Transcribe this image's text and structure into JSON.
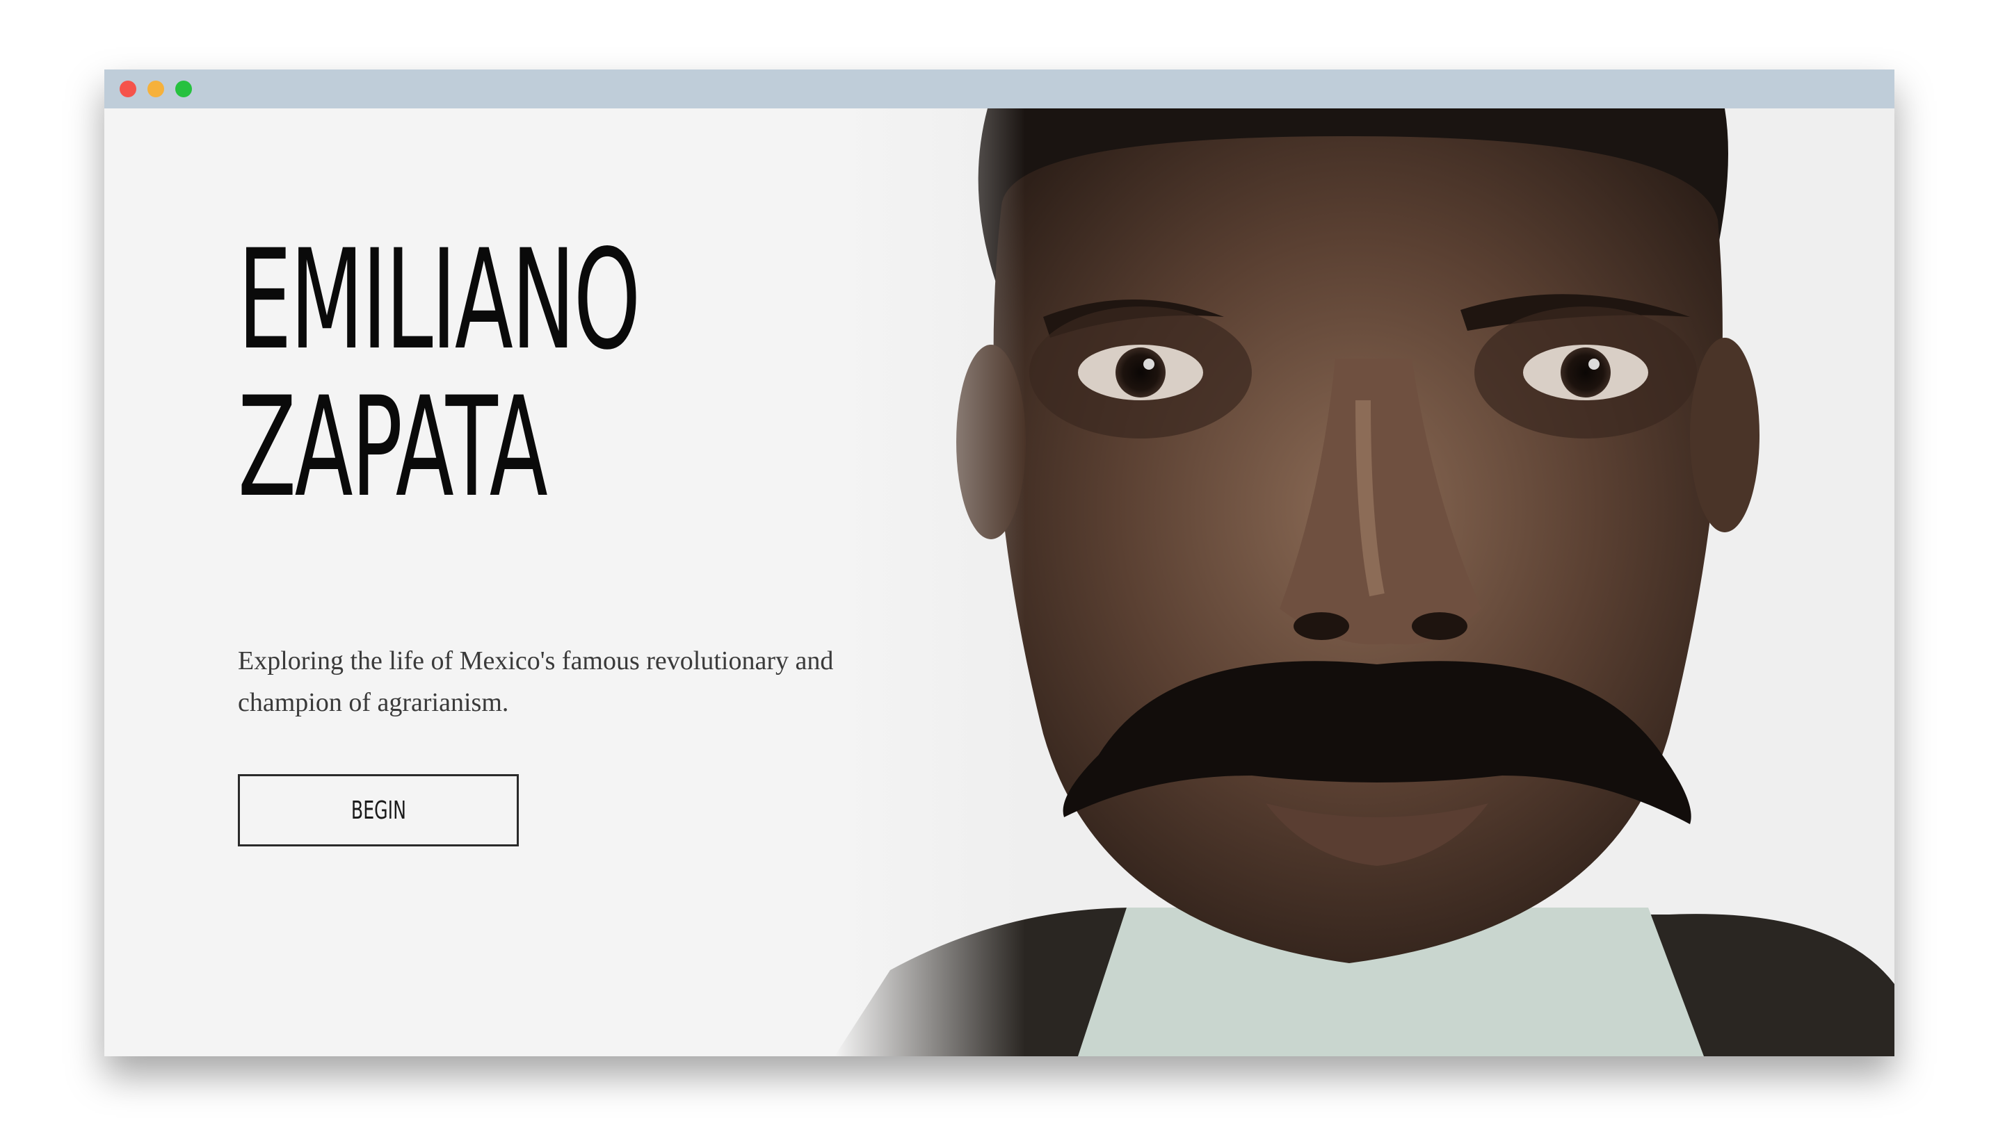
{
  "window": {
    "controls": [
      "close",
      "minimize",
      "maximize"
    ],
    "controls_colors": {
      "close": "#f5534b",
      "minimize": "#f6b13b",
      "maximize": "#26c13f"
    },
    "titlebar_color": "#bfcdd9"
  },
  "hero": {
    "title_line1": "EMILIANO",
    "title_line2": "ZAPATA",
    "subtitle": "Exploring the life of Mexico's famous revolutionary and champion of agrarianism.",
    "button_label": "BEGIN",
    "image": "portrait-photo"
  }
}
